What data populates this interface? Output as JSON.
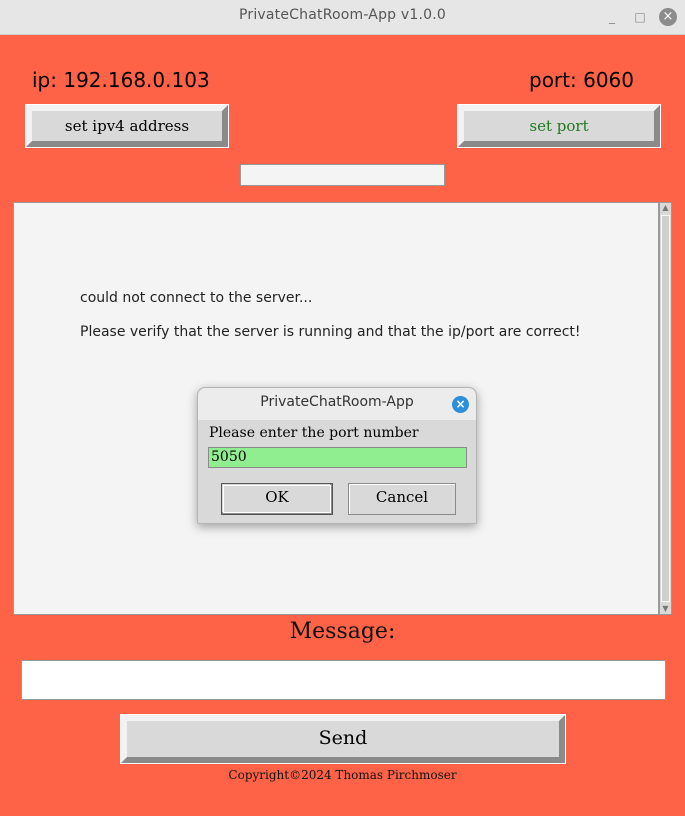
{
  "window": {
    "title": "PrivateChatRoom-App v1.0.0",
    "controls": {
      "minimize": "_",
      "maximize": "□",
      "close": "×"
    }
  },
  "connection": {
    "ip_text": "ip: 192.168.0.103",
    "port_text": "port: 6060",
    "set_ip_label": "set ipv4 address",
    "set_port_label": "set port"
  },
  "log": {
    "lines": [
      "could not connect to the server...",
      "Please verify that the server is running and that the ip/port are correct!"
    ]
  },
  "message": {
    "label": "Message:",
    "value": "",
    "send_label": "Send"
  },
  "footer": {
    "copyright": "Copyright©2024 Thomas Pirchmoser"
  },
  "dialog": {
    "title": "PrivateChatRoom-App",
    "prompt": "Please enter the port number",
    "input_value": "5050",
    "ok_label": "OK",
    "cancel_label": "Cancel",
    "close_glyph": "×"
  },
  "colors": {
    "background": "#ff6347",
    "input_highlight": "#90ee90",
    "port_button_text": "#1e7a1e",
    "dialog_close": "#2e8fd8"
  }
}
